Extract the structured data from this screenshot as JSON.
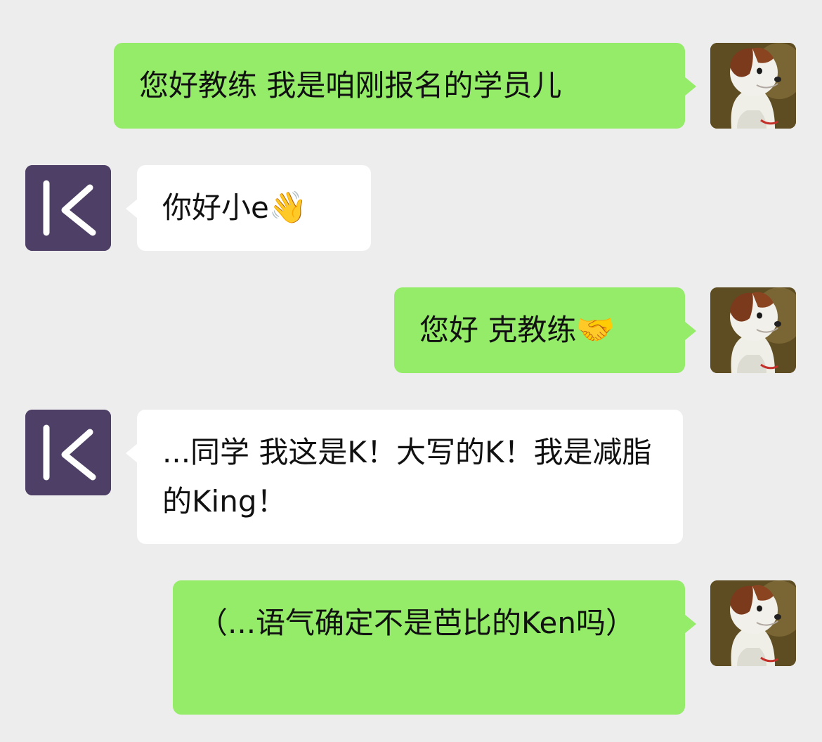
{
  "messages": [
    {
      "sender": "user",
      "text": "您好教练 我是咱刚报名的学员儿",
      "emoji": ""
    },
    {
      "sender": "coach",
      "text": "你好小e",
      "emoji": "👋"
    },
    {
      "sender": "user",
      "text": "您好 克教练",
      "emoji": "🤝"
    },
    {
      "sender": "coach",
      "text": "...同学 我这是K！大写的K！我是减脂的King！",
      "emoji": ""
    },
    {
      "sender": "user",
      "text": "（...语气确定不是芭比的Ken吗）",
      "emoji": ""
    }
  ],
  "colors": {
    "background": "#ededed",
    "outgoing_bubble": "#95ec69",
    "incoming_bubble": "#ffffff",
    "coach_avatar": "#4e3f66",
    "coach_logo": "#ffffff"
  },
  "icons": {
    "coach_avatar": "keep-k-logo-icon",
    "user_avatar": "dog-portrait-avatar"
  }
}
